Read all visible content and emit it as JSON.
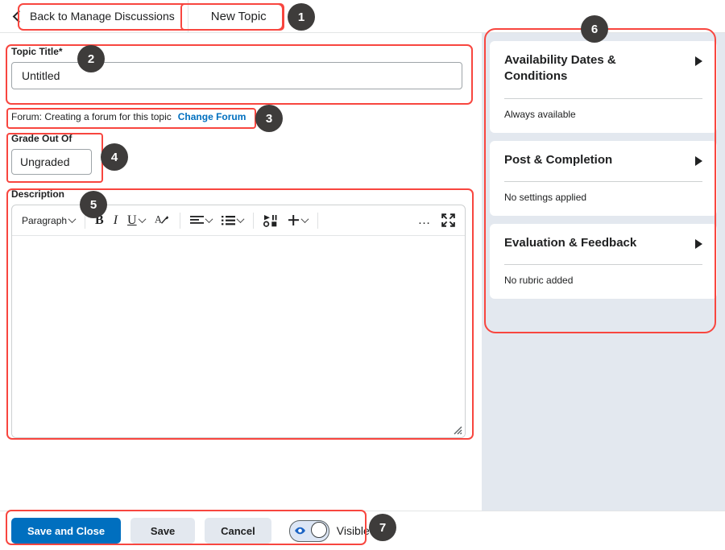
{
  "header": {
    "back_label": "Back to Manage Discussions",
    "back_icon": "chevron-left-icon",
    "tab_label": "New Topic"
  },
  "form": {
    "title_label": "Topic Title",
    "title_required_marker": "*",
    "title_value": "Untitled",
    "title_placeholder": "Untitled",
    "forum_text": "Forum: Creating a forum for this topic",
    "change_forum_link": "Change Forum",
    "grade_label": "Grade Out Of",
    "grade_value": "Ungraded",
    "grade_placeholder": "Ungraded",
    "description_label": "Description"
  },
  "editor": {
    "paragraph_style": "Paragraph",
    "buttons": {
      "bold": "B",
      "italic": "I",
      "underline": "U",
      "clear_formatting": "A",
      "align": "align-left-icon",
      "list": "bulleted-list-icon",
      "insert_stuff": "insert-media-icon",
      "insert_plus": "+",
      "more": "…",
      "fullscreen": "fullscreen-icon"
    },
    "content": ""
  },
  "sidebar": {
    "panels": [
      {
        "title": "Availability Dates & Conditions",
        "summary": "Always available",
        "expand_icon": "triangle-right-icon"
      },
      {
        "title": "Post & Completion",
        "summary": "No settings applied",
        "expand_icon": "triangle-right-icon"
      },
      {
        "title": "Evaluation & Feedback",
        "summary": "No rubric added",
        "expand_icon": "triangle-right-icon"
      }
    ]
  },
  "footer": {
    "save_and_close": "Save and Close",
    "save": "Save",
    "cancel": "Cancel",
    "visibility_label": "Visible",
    "visibility_icon": "eye-icon",
    "visibility_on": true
  },
  "annotations": {
    "badges": [
      "1",
      "2",
      "3",
      "4",
      "5",
      "6",
      "7"
    ]
  },
  "colors": {
    "accent_blue": "#006fbf",
    "annotation_red": "#f8463f",
    "badge_gray": "#3e3c3b",
    "sidebar_bg": "#e3e8ef"
  }
}
